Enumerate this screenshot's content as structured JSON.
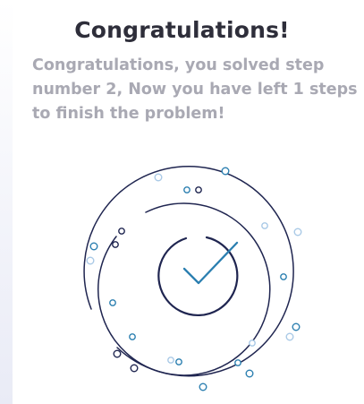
{
  "dialog": {
    "title": "Congratulations!",
    "message": "Congratulations, you solved step number 2, Now you have left 1 steps to finish the problem!"
  },
  "illustration": {
    "icon": "check-circle-icon",
    "colors": {
      "ring": "#1f2550",
      "check": "#2b7fb0",
      "dot": "#2b7fb0",
      "dot_light": "#a9c9e6"
    }
  }
}
